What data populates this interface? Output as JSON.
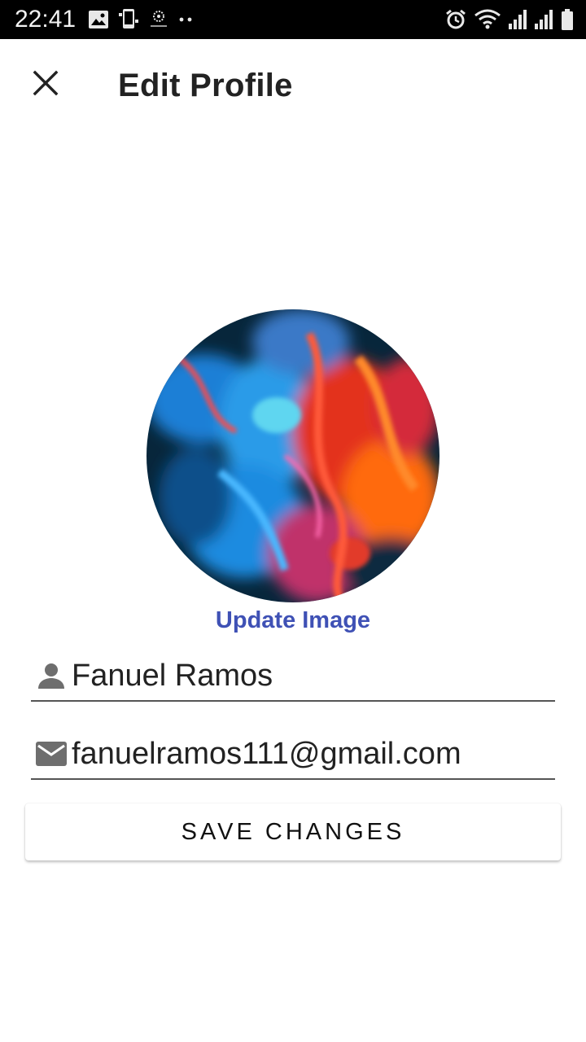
{
  "status_bar": {
    "time": "22:41",
    "left_icons": [
      "image-icon",
      "screenshot-phone-icon",
      "settings-app-icon",
      "more-dots-icon"
    ],
    "right_icons": [
      "alarm-icon",
      "wifi-icon",
      "signal-icon",
      "signal-icon",
      "battery-icon"
    ]
  },
  "toolbar": {
    "title": "Edit Profile",
    "close_icon": "close-icon"
  },
  "profile": {
    "update_image_label": "Update Image",
    "name_value": "Fanuel Ramos",
    "email_value": "fanuelramos111@gmail.com"
  },
  "actions": {
    "save_label": "SAVE CHANGES"
  },
  "colors": {
    "accent": "#3f51b5",
    "status_bar": "#000000",
    "text_primary": "#222222",
    "underline": "#555555"
  }
}
